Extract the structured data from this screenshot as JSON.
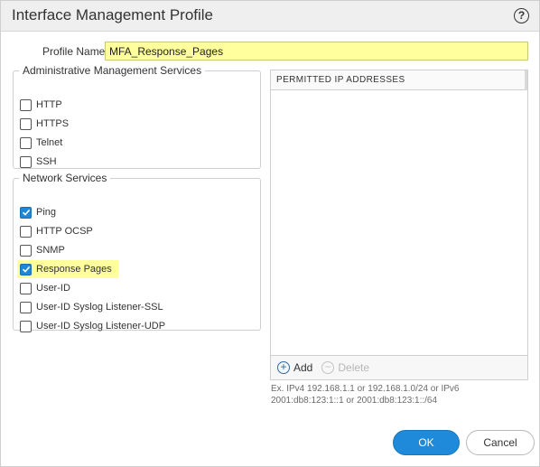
{
  "dialog": {
    "title": "Interface Management Profile",
    "help_icon": "question-circle-icon",
    "help_glyph": "?"
  },
  "profile": {
    "label": "Profile Name",
    "value": "MFA_Response_Pages"
  },
  "admin_services": {
    "legend": "Administrative Management Services",
    "items": [
      {
        "label": "HTTP",
        "checked": false
      },
      {
        "label": "HTTPS",
        "checked": false
      },
      {
        "label": "Telnet",
        "checked": false
      },
      {
        "label": "SSH",
        "checked": false
      }
    ]
  },
  "network_services": {
    "legend": "Network Services",
    "items": [
      {
        "label": "Ping",
        "checked": true
      },
      {
        "label": "HTTP OCSP",
        "checked": false
      },
      {
        "label": "SNMP",
        "checked": false
      },
      {
        "label": "Response Pages",
        "checked": true,
        "highlighted": true
      },
      {
        "label": "User-ID",
        "checked": false
      },
      {
        "label": "User-ID Syslog Listener-SSL",
        "checked": false
      },
      {
        "label": "User-ID Syslog Listener-UDP",
        "checked": false
      }
    ]
  },
  "permitted_ips": {
    "header": "PERMITTED IP ADDRESSES",
    "entries": [],
    "add_label": "Add",
    "delete_label": "Delete",
    "add_glyph": "+",
    "delete_glyph": "−",
    "hint": "Ex. IPv4 192.168.1.1 or 192.168.1.0/24 or IPv6 2001:db8:123:1::1 or 2001:db8:123:1::/64"
  },
  "buttons": {
    "ok": "OK",
    "cancel": "Cancel"
  },
  "colors": {
    "accent": "#1f8ad9",
    "highlight": "#ffff9e",
    "checkbox_checked": "#1f87d6",
    "title_bg": "#efefef"
  }
}
